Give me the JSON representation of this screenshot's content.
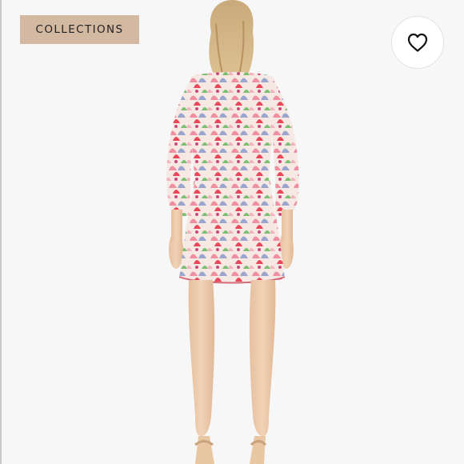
{
  "badge": {
    "label": "COLLECTIONS",
    "background": "#d3b8a2"
  },
  "like_button": {
    "icon": "heart-outline-icon"
  },
  "photo": {
    "subject": "model-back-view",
    "palette": [
      "#f2a7b5",
      "#e8485a",
      "#8d9bc6",
      "#6fb46a",
      "#f0c6cf",
      "#f5ece2"
    ]
  }
}
